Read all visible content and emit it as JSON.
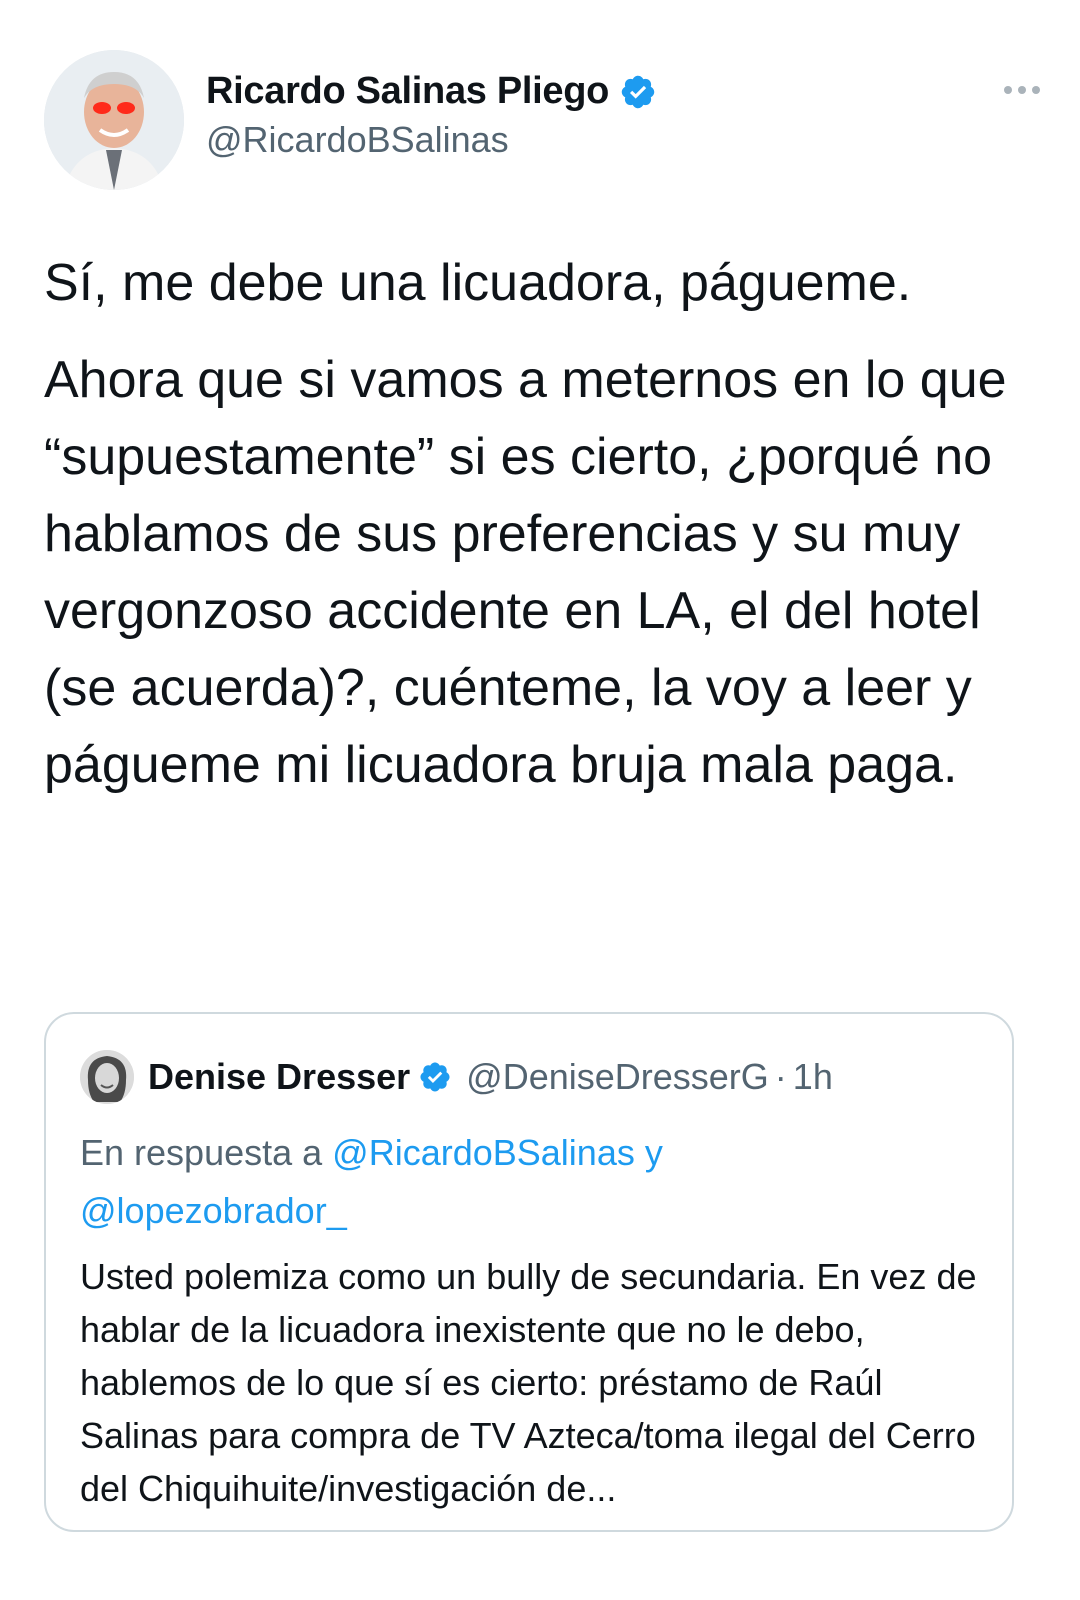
{
  "tweet": {
    "author": {
      "display_name": "Ricardo Salinas Pliego",
      "handle": "@RicardoBSalinas",
      "verified": true
    },
    "more_icon": "more-horizontal-icon",
    "paragraphs": [
      "Sí, me debe una licuadora, págueme.",
      "Ahora que si vamos a meternos en lo que “supuestamente” si es cierto, ¿porqué no hablamos de sus preferencias y su muy vergonzoso accidente en LA, el del hotel (se acuerda)?, cuénteme, la voy a leer y págueme mi licuadora bruja mala paga."
    ]
  },
  "quote": {
    "author": {
      "display_name": "Denise Dresser",
      "handle": "@DeniseDresserG",
      "separator": "·",
      "time": "1h",
      "verified": true
    },
    "reply_prefix": "En respuesta a",
    "reply_mention_1": "@RicardoBSalinas",
    "reply_conjunction": "y",
    "reply_mention_2": "@lopezobrador_",
    "text": "Usted polemiza como un bully de secundaria. En vez de hablar de la licuadora inexistente que no le debo, hablemos de lo que sí es cierto: préstamo de Raúl Salinas para compra de TV Azteca/toma ilegal del Cerro del Chiquihuite/investigación de..."
  },
  "colors": {
    "text": "#0f1419",
    "secondary": "#536471",
    "link": "#1d9bf0",
    "verified": "#1d9bf0",
    "border": "#cfd9de"
  }
}
